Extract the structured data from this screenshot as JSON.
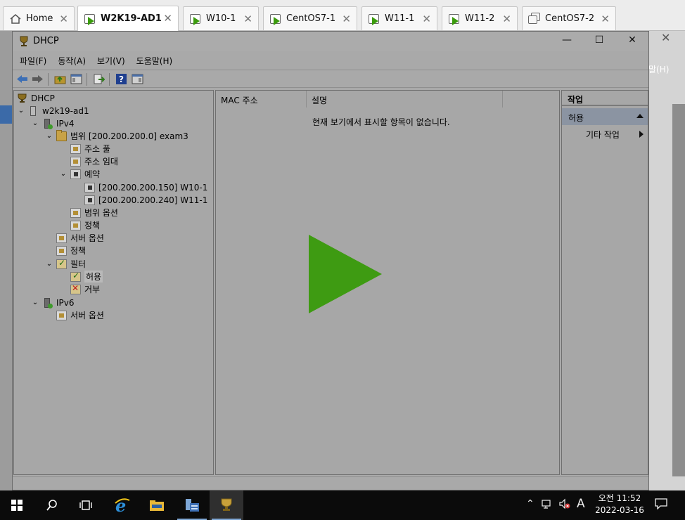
{
  "vm_tabs": [
    {
      "label": "Home",
      "icon": "home-icon"
    },
    {
      "label": "W2K19-AD1",
      "icon": "vm-running-icon",
      "active": true
    },
    {
      "label": "W10-1",
      "icon": "vm-running-icon"
    },
    {
      "label": "CentOS7-1",
      "icon": "vm-running-icon"
    },
    {
      "label": "W11-1",
      "icon": "vm-running-icon"
    },
    {
      "label": "W11-2",
      "icon": "vm-running-icon"
    },
    {
      "label": "CentOS7-2",
      "icon": "vm-stack-icon"
    }
  ],
  "background": {
    "help_menu": "말(H)"
  },
  "window": {
    "title": "DHCP",
    "minimize": "—",
    "maximize": "☐",
    "close": "✕"
  },
  "menu": [
    "파일(F)",
    "동작(A)",
    "보기(V)",
    "도움말(H)"
  ],
  "tree": [
    {
      "label": "DHCP",
      "icon": "dhcp-icon"
    },
    {
      "label": "w2k19-ad1",
      "icon": "server-icon",
      "expanded": true
    },
    {
      "label": "IPv4",
      "icon": "ipv4-icon",
      "expanded": true
    },
    {
      "label": "범위 [200.200.200.0] exam3",
      "icon": "scope-folder-icon",
      "expanded": true
    },
    {
      "label": "주소 풀",
      "icon": "address-pool-icon"
    },
    {
      "label": "주소 임대",
      "icon": "address-lease-icon"
    },
    {
      "label": "예약",
      "icon": "reservations-icon",
      "expanded": true
    },
    {
      "label": "[200.200.200.150] W10-1",
      "icon": "reservation-icon"
    },
    {
      "label": "[200.200.200.240] W11-1",
      "icon": "reservation-icon"
    },
    {
      "label": "범위 옵션",
      "icon": "scope-options-icon"
    },
    {
      "label": "정책",
      "icon": "policy-icon"
    },
    {
      "label": "서버 옵션",
      "icon": "server-options-icon"
    },
    {
      "label": "정책",
      "icon": "policy-icon"
    },
    {
      "label": "필터",
      "icon": "filter-icon",
      "expanded": true
    },
    {
      "label": "허용",
      "icon": "allow-filter-icon",
      "selected": true
    },
    {
      "label": "거부",
      "icon": "deny-filter-icon"
    },
    {
      "label": "IPv6",
      "icon": "ipv6-icon",
      "expanded": true
    },
    {
      "label": "서버 옵션",
      "icon": "server-options-icon"
    }
  ],
  "center": {
    "columns": [
      "MAC 주소",
      "설명"
    ],
    "empty_message": "현재 보기에서 표시할 항목이 없습니다."
  },
  "actions": {
    "title": "작업",
    "section": "허용",
    "more_actions": "기타 작업"
  },
  "taskbar": {
    "clock_time": "오전 11:52",
    "clock_date": "2022-03-16",
    "ime": "A"
  }
}
